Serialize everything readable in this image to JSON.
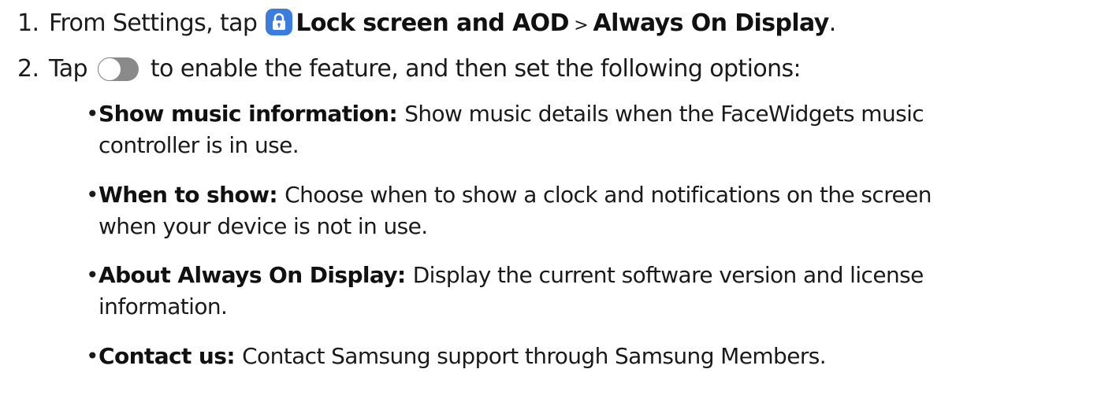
{
  "steps": [
    {
      "number": "1.",
      "prefix": "From Settings, tap ",
      "icon": "lock-icon",
      "link1": "Lock screen and AOD",
      "separator": " > ",
      "link2": "Always On Display",
      "suffix": "."
    },
    {
      "number": "2.",
      "prefix": "Tap ",
      "icon": "toggle-icon",
      "text": " to enable the feature, and then set the following options:"
    }
  ],
  "options": [
    {
      "term": "Show music information",
      "colon": ": ",
      "line1": "Show music details when the FaceWidgets music",
      "line2": "controller is in use."
    },
    {
      "term": "When to show",
      "colon": ": ",
      "line1": "Choose when to show a clock and notifications on the screen",
      "line2": "when your device is not in use."
    },
    {
      "term": "About Always On Display",
      "colon": ": ",
      "line1": "Display the current software version and license",
      "line2": "information."
    },
    {
      "term": "Contact us",
      "colon": ": ",
      "line1": "Contact Samsung support through Samsung Members.",
      "line2": ""
    }
  ],
  "colors": {
    "text": "#1a1a1a",
    "icon_blue": "#3b7ddd",
    "toggle_gray": "#8a8a8a"
  }
}
